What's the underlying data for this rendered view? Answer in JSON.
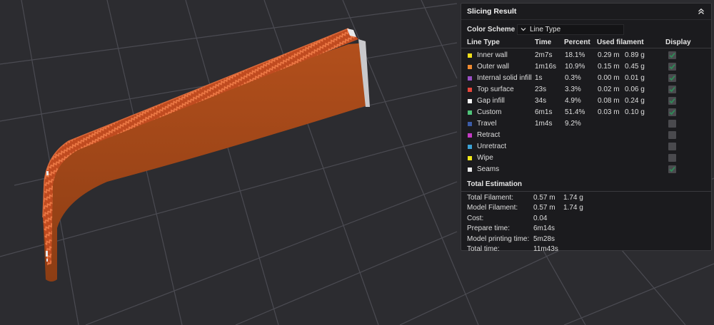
{
  "panel": {
    "title": "Slicing Result",
    "color_scheme_label": "Color Scheme",
    "color_scheme_value": "Line Type"
  },
  "columns": {
    "line_type": "Line Type",
    "time": "Time",
    "percent": "Percent",
    "used_filament": "Used filament",
    "display": "Display"
  },
  "line_types": [
    {
      "name": "Inner wall",
      "color": "#f2e01a",
      "time": "2m7s",
      "percent": "18.1%",
      "length": "0.29 m",
      "weight": "0.89 g",
      "display": true
    },
    {
      "name": "Outer wall",
      "color": "#f08a30",
      "time": "1m16s",
      "percent": "10.9%",
      "length": "0.15 m",
      "weight": "0.45 g",
      "display": true
    },
    {
      "name": "Internal solid infill",
      "color": "#9a4fc4",
      "time": "1s",
      "percent": "0.3%",
      "length": "0.00 m",
      "weight": "0.01 g",
      "display": true
    },
    {
      "name": "Top surface",
      "color": "#e8463b",
      "time": "23s",
      "percent": "3.3%",
      "length": "0.02 m",
      "weight": "0.06 g",
      "display": true
    },
    {
      "name": "Gap infill",
      "color": "#f4f4f4",
      "time": "34s",
      "percent": "4.9%",
      "length": "0.08 m",
      "weight": "0.24 g",
      "display": true
    },
    {
      "name": "Custom",
      "color": "#4fc47a",
      "time": "6m1s",
      "percent": "51.4%",
      "length": "0.03 m",
      "weight": "0.10 g",
      "display": true
    },
    {
      "name": "Travel",
      "color": "#3b5ca8",
      "time": "1m4s",
      "percent": "9.2%",
      "length": "",
      "weight": "",
      "display": false
    },
    {
      "name": "Retract",
      "color": "#c53bc5",
      "time": "",
      "percent": "",
      "length": "",
      "weight": "",
      "display": false
    },
    {
      "name": "Unretract",
      "color": "#3ba3d6",
      "time": "",
      "percent": "",
      "length": "",
      "weight": "",
      "display": false
    },
    {
      "name": "Wipe",
      "color": "#f2e81a",
      "time": "",
      "percent": "",
      "length": "",
      "weight": "",
      "display": false
    },
    {
      "name": "Seams",
      "color": "#e8e8e8",
      "time": "",
      "percent": "",
      "length": "",
      "weight": "",
      "display": true
    }
  ],
  "total_estimation": {
    "title": "Total Estimation",
    "rows": [
      {
        "label": "Total Filament:",
        "v1": "0.57 m",
        "v2": "1.74 g"
      },
      {
        "label": "Model Filament:",
        "v1": "0.57 m",
        "v2": "1.74 g"
      },
      {
        "label": "Cost:",
        "v1": "0.04",
        "v2": ""
      },
      {
        "label": "Prepare time:",
        "v1": "6m14s",
        "v2": ""
      },
      {
        "label": "Model printing time:",
        "v1": "5m28s",
        "v2": ""
      },
      {
        "label": "Total time:",
        "v1": "11m43s",
        "v2": ""
      }
    ]
  },
  "colors": {
    "background": "#2c2c30",
    "grid": "#4a4a50",
    "model_body": "#a44a1a",
    "model_top": "#c8562a",
    "pattern": "#e06a3c",
    "check": "#2e8b57"
  }
}
